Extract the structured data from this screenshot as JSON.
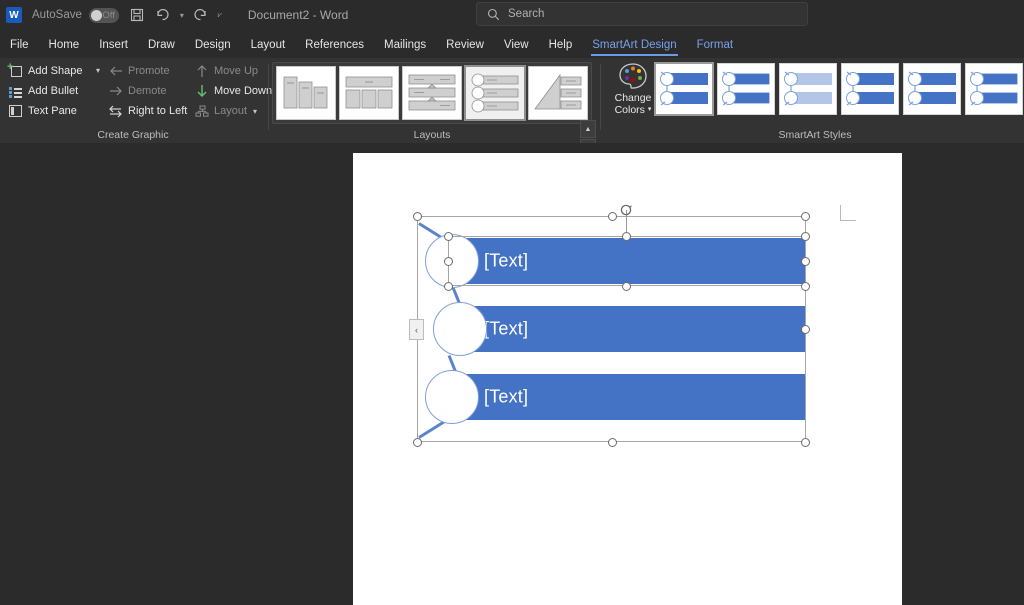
{
  "titlebar": {
    "logo_text": "W",
    "autosave_label": "AutoSave",
    "autosave_state": "Off",
    "save_icon": "save-icon",
    "undo_icon": "undo-icon",
    "redo_icon": "redo-icon",
    "customize_icon": "customize-quick-access-icon",
    "document_title": "Document2  -  Word"
  },
  "search": {
    "placeholder": "Search",
    "icon": "search-icon"
  },
  "tabs": [
    {
      "label": "File",
      "state": "normal"
    },
    {
      "label": "Home",
      "state": "normal"
    },
    {
      "label": "Insert",
      "state": "normal"
    },
    {
      "label": "Draw",
      "state": "normal"
    },
    {
      "label": "Design",
      "state": "normal"
    },
    {
      "label": "Layout",
      "state": "normal"
    },
    {
      "label": "References",
      "state": "normal"
    },
    {
      "label": "Mailings",
      "state": "normal"
    },
    {
      "label": "Review",
      "state": "normal"
    },
    {
      "label": "View",
      "state": "normal"
    },
    {
      "label": "Help",
      "state": "normal"
    },
    {
      "label": "SmartArt Design",
      "state": "active"
    },
    {
      "label": "Format",
      "state": "contextual"
    }
  ],
  "ribbon": {
    "create_graphic": {
      "group_label": "Create Graphic",
      "items": [
        {
          "label": "Add Shape",
          "icon": "add-shape-icon",
          "enabled": true,
          "has_caret": true
        },
        {
          "label": "Add Bullet",
          "icon": "add-bullet-icon",
          "enabled": true,
          "has_caret": false
        },
        {
          "label": "Text Pane",
          "icon": "text-pane-icon",
          "enabled": true,
          "has_caret": false
        },
        {
          "label": "Promote",
          "icon": "promote-icon",
          "enabled": false,
          "has_caret": false
        },
        {
          "label": "Demote",
          "icon": "demote-icon",
          "enabled": false,
          "has_caret": false
        },
        {
          "label": "Right to Left",
          "icon": "right-to-left-icon",
          "enabled": true,
          "has_caret": false
        },
        {
          "label": "Move Up",
          "icon": "move-up-icon",
          "enabled": false,
          "has_caret": false
        },
        {
          "label": "Move Down",
          "icon": "move-down-icon",
          "enabled": true,
          "has_caret": false
        },
        {
          "label": "Layout",
          "icon": "layout-icon",
          "enabled": false,
          "has_caret": true
        }
      ]
    },
    "layouts": {
      "group_label": "Layouts",
      "selected_index": 3,
      "thumbnails": [
        {
          "name": "layout-thumb-staggered-blocks"
        },
        {
          "name": "layout-thumb-header-columns"
        },
        {
          "name": "layout-thumb-process-rows"
        },
        {
          "name": "layout-thumb-circle-bars"
        },
        {
          "name": "layout-thumb-triangle-list"
        }
      ],
      "scroll_up_icon": "scroll-up-icon",
      "scroll_down_icon": "scroll-down-icon",
      "more_icon": "more-layouts-icon"
    },
    "change_colors": {
      "label_line1": "Change",
      "label_line2": "Colors",
      "icon": "color-palette-icon",
      "has_caret": true
    },
    "smartart_styles": {
      "group_label": "SmartArt Styles",
      "selected_index": 0,
      "thumbnails": [
        {
          "name": "style-thumb-simple-fill"
        },
        {
          "name": "style-thumb-white-outline"
        },
        {
          "name": "style-thumb-subtle-effect"
        },
        {
          "name": "style-thumb-moderate-effect"
        },
        {
          "name": "style-thumb-intense-effect"
        },
        {
          "name": "style-thumb-polished"
        },
        {
          "name": "style-thumb-inset"
        }
      ]
    }
  },
  "document": {
    "page_name": "document-page",
    "margin_marker": "margin-corner-marker",
    "smartart": {
      "name": "smartart-graphic",
      "selected": true,
      "selected_shape_index": 0,
      "rotate_handle": "rotate-handle",
      "text_pane_toggle": "text-pane-toggle",
      "text_pane_toggle_glyph": "‹",
      "shapes": [
        {
          "text": "[Text]"
        },
        {
          "text": "[Text]"
        },
        {
          "text": "[Text]"
        }
      ]
    }
  },
  "colors": {
    "accent_blue": "#4472c4",
    "ribbon_bg": "#333333",
    "titlebar_bg": "#2b2b2b",
    "workspace_bg": "#2b2b2b",
    "page_bg": "#ffffff",
    "active_tab": "#7aa1e8",
    "handle_stroke": "#6b6b6b"
  }
}
